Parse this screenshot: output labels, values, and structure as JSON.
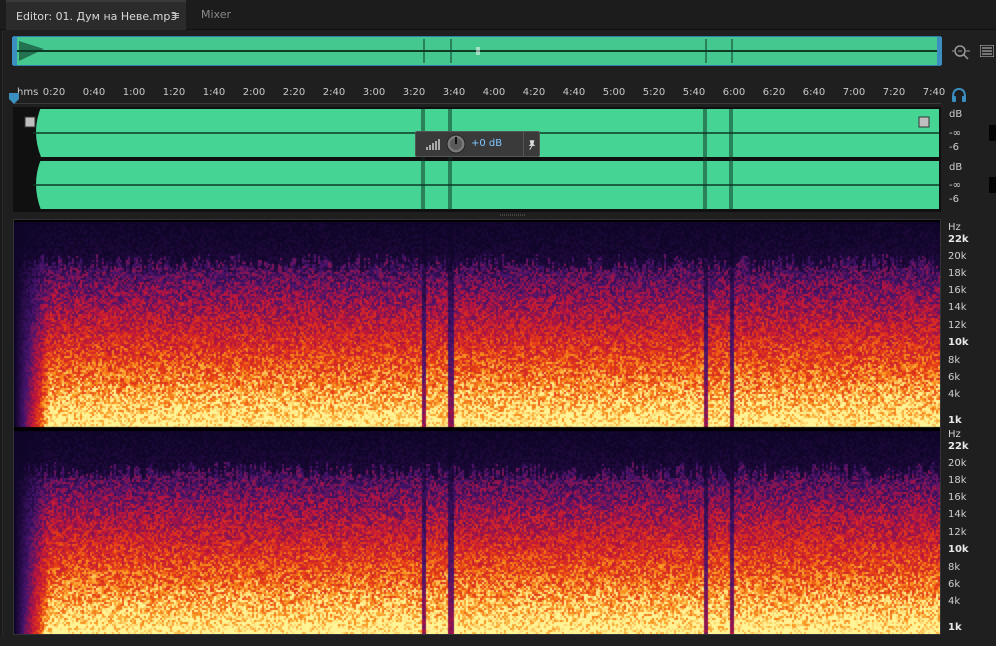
{
  "tabs": {
    "editor_label": "Editor: 01. Дум на Неве.mp3",
    "editor_menu_glyph": "≡",
    "mixer_label": "Mixer"
  },
  "ruler": {
    "units": "hms",
    "labels": [
      "0:20",
      "0:40",
      "1:00",
      "1:20",
      "1:40",
      "2:00",
      "2:20",
      "2:40",
      "3:00",
      "3:20",
      "3:40",
      "4:00",
      "4:20",
      "4:40",
      "5:00",
      "5:20",
      "5:40",
      "6:00",
      "6:20",
      "6:40",
      "7:00",
      "7:20",
      "7:40"
    ]
  },
  "waveform": {
    "channel1_db": [
      "dB",
      "-∞",
      "-6"
    ],
    "channel2_db": [
      "dB",
      "-∞",
      "-6"
    ],
    "color": "#45d494"
  },
  "hud": {
    "value": "+0 dB"
  },
  "spectral": {
    "channel1_hz": [
      "Hz",
      "22k",
      "20k",
      "18k",
      "16k",
      "14k",
      "12k",
      "10k",
      "8k",
      "6k",
      "4k",
      "1k"
    ],
    "channel2_hz": [
      "Hz",
      "22k",
      "20k",
      "18k",
      "16k",
      "14k",
      "12k",
      "10k",
      "8k",
      "6k",
      "4k",
      "1k"
    ]
  },
  "icons": {
    "zoom": "zoom-icon",
    "panel": "panel-menu-icon",
    "headphones": "headphones-icon",
    "pin": "pin-icon"
  },
  "colors": {
    "waveform": "#45d494",
    "accent": "#3a8fc0",
    "hud_text": "#7ec8ff"
  }
}
